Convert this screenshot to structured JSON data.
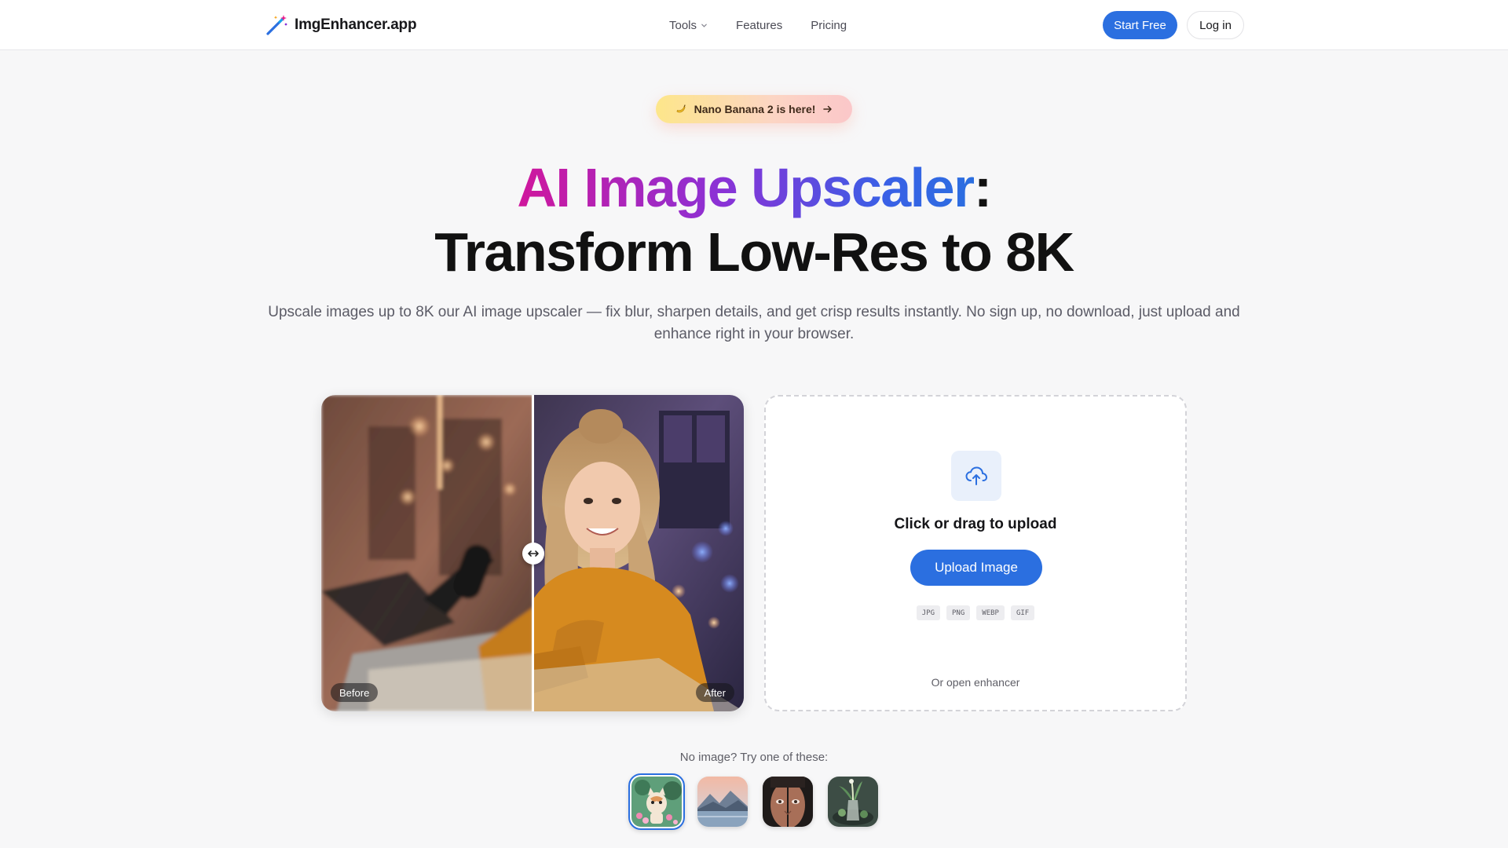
{
  "header": {
    "logo_text": "ImgEnhancer.app",
    "nav": {
      "tools": "Tools",
      "features": "Features",
      "pricing": "Pricing"
    },
    "start_free": "Start Free",
    "log_in": "Log in"
  },
  "promo": {
    "text": "Nano Banana 2 is here!"
  },
  "hero": {
    "title_gradient": "AI Image Upscaler",
    "title_colon": ":",
    "title_line2": "Transform Low-Res to 8K",
    "subtitle": "Upscale images up to 8K our AI image upscaler — fix blur, sharpen details, and get crisp results instantly. No sign up, no download, just upload and enhance right in your browser."
  },
  "compare": {
    "before_label": "Before",
    "after_label": "After",
    "slider_position": 0.5
  },
  "upload": {
    "title": "Click or drag to upload",
    "button": "Upload Image",
    "formats": [
      "JPG",
      "PNG",
      "WEBP",
      "GIF"
    ],
    "alt_link": "Or open enhancer"
  },
  "samples": {
    "prompt": "No image? Try one of these:",
    "items": [
      "cartoon-cat",
      "mountain-lake",
      "portrait-face",
      "still-life"
    ],
    "selected_index": 0
  },
  "colors": {
    "accent": "#2b6fe0",
    "gradient_start": "#d0179c",
    "gradient_end": "#2b6fe0"
  }
}
